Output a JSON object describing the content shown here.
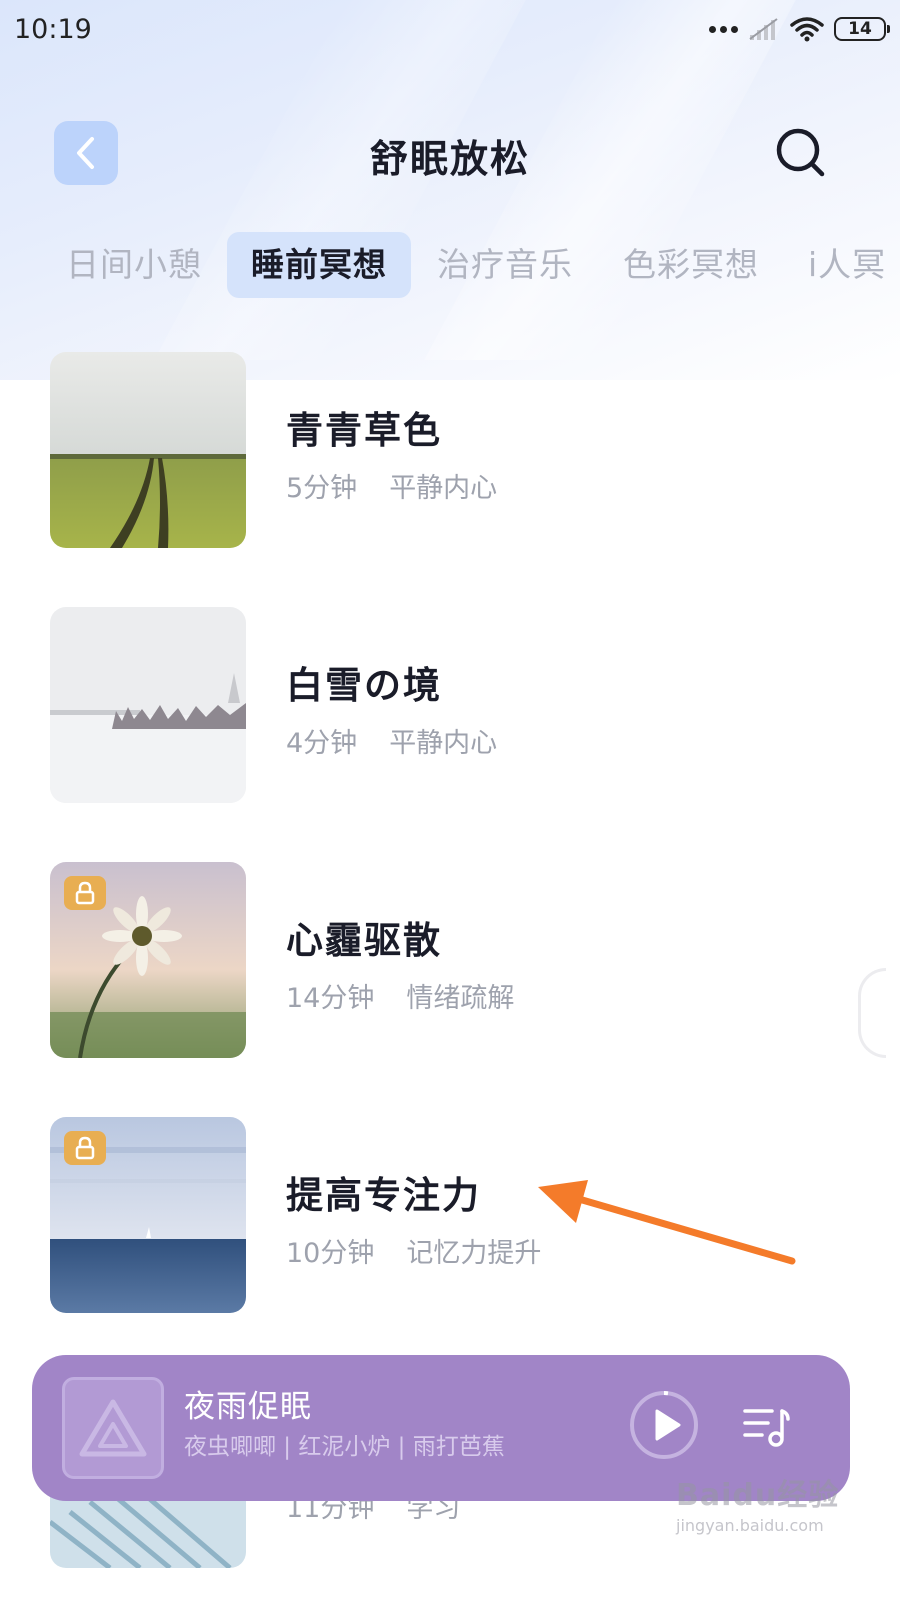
{
  "status_bar": {
    "time": "10:19",
    "battery": "14"
  },
  "header": {
    "title": "舒眠放松"
  },
  "tabs": [
    {
      "label": "日间小憩",
      "active": false
    },
    {
      "label": "睡前冥想",
      "active": true
    },
    {
      "label": "治疗音乐",
      "active": false
    },
    {
      "label": "色彩冥想",
      "active": false
    },
    {
      "label": "i人冥",
      "active": false
    }
  ],
  "list": [
    {
      "title": "青青草色",
      "duration": "5分钟",
      "tag": "平静内心",
      "locked": false,
      "thumbnail": "wheat-field-icon"
    },
    {
      "title": "白雪の境",
      "duration": "4分钟",
      "tag": "平静内心",
      "locked": false,
      "thumbnail": "snow-landscape-icon"
    },
    {
      "title": "心霾驱散",
      "duration": "14分钟",
      "tag": "情绪疏解",
      "locked": true,
      "thumbnail": "daisy-flower-icon"
    },
    {
      "title": "提高专注力",
      "duration": "10分钟",
      "tag": "记忆力提升",
      "locked": true,
      "thumbnail": "calm-sea-icon"
    },
    {
      "title": "",
      "duration": "11分钟",
      "tag": "学习",
      "locked": false,
      "thumbnail": "architecture-icon"
    }
  ],
  "player": {
    "title": "夜雨促眠",
    "subtitle": "夜虫唧唧 | 红泥小炉 | 雨打芭蕉"
  },
  "watermark": {
    "logo": "Baidu经验",
    "url": "jingyan.baidu.com"
  },
  "colors": {
    "player_bg": "#a185c7",
    "active_tab_bg": "#d5e3fb",
    "back_button_bg": "#bcd3fb",
    "lock_badge": "#e8ae52",
    "annotation_arrow": "#f47b2a"
  }
}
